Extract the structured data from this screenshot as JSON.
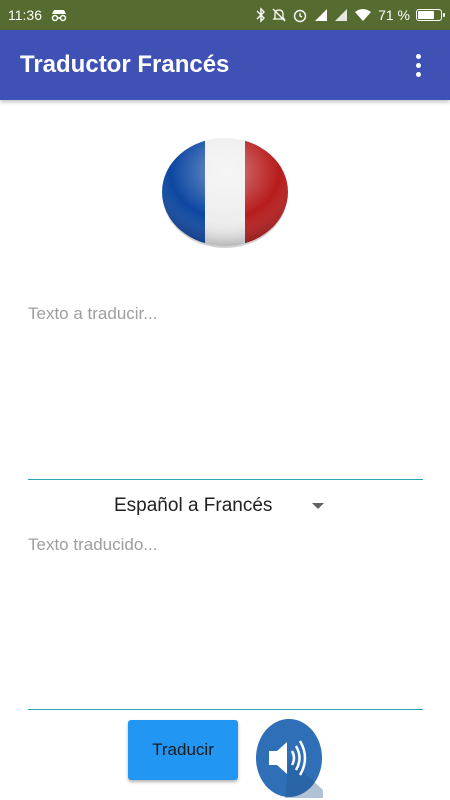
{
  "status_bar": {
    "time": "11:36",
    "battery_percent": "71 %",
    "battery_level": 0.71,
    "icons": [
      "incognito-icon",
      "bluetooth-icon",
      "mute-icon",
      "alarm-icon",
      "signal-icon",
      "signal-icon",
      "wifi-icon",
      "battery-icon"
    ]
  },
  "app_bar": {
    "title": "Traductor Francés",
    "menu_icon": "overflow-menu-icon",
    "color": "#3f51b5"
  },
  "flag": {
    "icon": "france-flag-icon",
    "colors": [
      "#0d47a1",
      "#eeeeee",
      "#b71c1c"
    ]
  },
  "source": {
    "placeholder": "Texto a traducir...",
    "value": ""
  },
  "language_selector": {
    "selected": "Español a Francés"
  },
  "target": {
    "placeholder": "Texto traducido...",
    "value": ""
  },
  "actions": {
    "translate_label": "Traducir",
    "speak_icon": "speaker-icon"
  }
}
